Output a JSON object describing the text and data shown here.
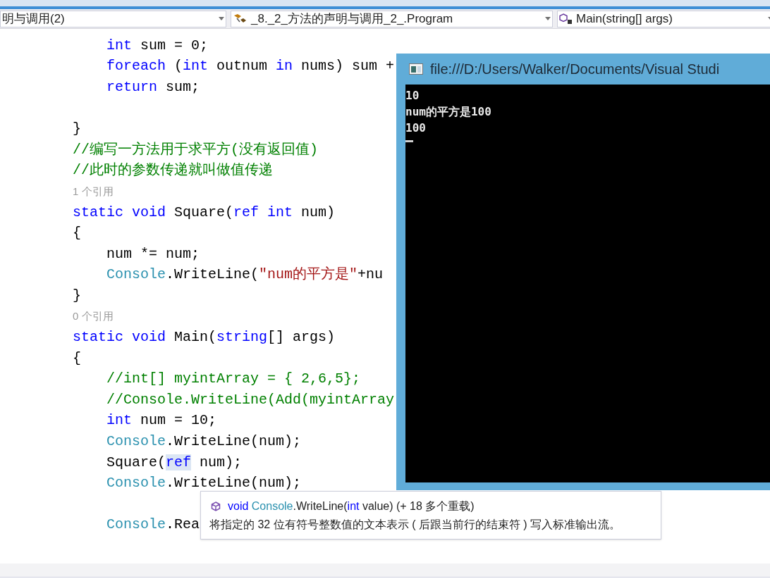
{
  "navigation_bar": {
    "dropdowns": [
      {
        "kind": "project",
        "text": "明与调用(2)"
      },
      {
        "kind": "class",
        "text": "_8._2_方法的声明与调用_2_.Program"
      },
      {
        "kind": "member",
        "text": "Main(string[] args)"
      }
    ]
  },
  "code_lines": [
    {
      "kind": "block",
      "children": [
        {
          "kind": "code",
          "tokens": [
            {
              "kind": "keyword",
              "text": "int"
            },
            {
              "kind": "plain",
              "text": " sum = 0;"
            }
          ]
        },
        {
          "kind": "code",
          "tokens": [
            {
              "kind": "keyword",
              "text": "foreach"
            },
            {
              "kind": "plain",
              "text": " ("
            },
            {
              "kind": "keyword",
              "text": "int"
            },
            {
              "kind": "plain",
              "text": " outnum "
            },
            {
              "kind": "keyword",
              "text": "in"
            },
            {
              "kind": "plain",
              "text": " nums) sum +"
            }
          ]
        },
        {
          "kind": "code",
          "tokens": [
            {
              "kind": "keyword",
              "text": "return"
            },
            {
              "kind": "plain",
              "text": " sum;"
            }
          ]
        },
        {
          "kind": "blank"
        }
      ]
    },
    {
      "kind": "code",
      "tokens": [
        {
          "kind": "plain",
          "text": "}"
        }
      ]
    },
    {
      "kind": "code",
      "tokens": [
        {
          "kind": "comment",
          "text": "//编写一方法用于求平方(没有返回值)"
        }
      ]
    },
    {
      "kind": "code",
      "tokens": [
        {
          "kind": "comment",
          "text": "//此时的参数传递就叫做值传递"
        }
      ]
    },
    {
      "kind": "codelens",
      "text": "1 个引用"
    },
    {
      "kind": "code",
      "tokens": [
        {
          "kind": "keyword",
          "text": "static void"
        },
        {
          "kind": "plain",
          "text": " Square("
        },
        {
          "kind": "keyword",
          "text": "ref int"
        },
        {
          "kind": "plain",
          "text": " num)"
        }
      ]
    },
    {
      "kind": "code",
      "tokens": [
        {
          "kind": "plain",
          "text": "{"
        }
      ]
    },
    {
      "kind": "block",
      "children": [
        {
          "kind": "code",
          "tokens": [
            {
              "kind": "plain",
              "text": "num *= num;"
            }
          ]
        },
        {
          "kind": "code",
          "tokens": [
            {
              "kind": "type",
              "text": "Console"
            },
            {
              "kind": "plain",
              "text": ".WriteLine("
            },
            {
              "kind": "string",
              "text": "\"num的平方是\""
            },
            {
              "kind": "plain",
              "text": "+nu"
            }
          ]
        }
      ]
    },
    {
      "kind": "code",
      "tokens": [
        {
          "kind": "plain",
          "text": "}"
        }
      ]
    },
    {
      "kind": "codelens",
      "text": "0 个引用"
    },
    {
      "kind": "code",
      "tokens": [
        {
          "kind": "keyword",
          "text": "static void"
        },
        {
          "kind": "plain",
          "text": " Main("
        },
        {
          "kind": "keyword",
          "text": "string"
        },
        {
          "kind": "plain",
          "text": "[] args)"
        }
      ]
    },
    {
      "kind": "code",
      "tokens": [
        {
          "kind": "plain",
          "text": "{"
        }
      ]
    },
    {
      "kind": "block",
      "children": [
        {
          "kind": "code",
          "tokens": [
            {
              "kind": "comment",
              "text": "//int[] myintArray = { 2,6,5};"
            }
          ]
        },
        {
          "kind": "code",
          "tokens": [
            {
              "kind": "comment",
              "text": "//Console.WriteLine(Add(myintArray"
            }
          ]
        },
        {
          "kind": "code",
          "tokens": [
            {
              "kind": "keyword",
              "text": "int"
            },
            {
              "kind": "plain",
              "text": " num = 10;"
            }
          ]
        },
        {
          "kind": "code",
          "tokens": [
            {
              "kind": "type",
              "text": "Console"
            },
            {
              "kind": "plain",
              "text": ".WriteLine(num);"
            }
          ]
        },
        {
          "kind": "code",
          "tokens": [
            {
              "kind": "plain",
              "text": "Square("
            },
            {
              "kind": "highlighted_keyword",
              "text": "ref"
            },
            {
              "kind": "plain",
              "text": " num);"
            }
          ]
        },
        {
          "kind": "code",
          "tokens": [
            {
              "kind": "type",
              "text": "Console"
            },
            {
              "kind": "plain",
              "text": ".WriteLine(num);"
            }
          ]
        },
        {
          "kind": "blank"
        },
        {
          "kind": "code",
          "tokens": [
            {
              "kind": "type",
              "text": "Console"
            },
            {
              "kind": "plain",
              "text": ".Rea"
            }
          ]
        }
      ]
    }
  ],
  "console_window": {
    "title": "file:///D:/Users/Walker/Documents/Visual Studi",
    "output_lines": [
      "10",
      "num的平方是100",
      "100"
    ]
  },
  "tooltip": {
    "signature": [
      {
        "kind": "keyword",
        "text": "void"
      },
      {
        "kind": "type",
        "text": " Console"
      },
      {
        "kind": "plain",
        "text": ".WriteLine("
      },
      {
        "kind": "keyword",
        "text": "int"
      },
      {
        "kind": "plain",
        "text": " value) (+ 18 多个重载)"
      }
    ],
    "description": "将指定的 32 位有符号整数值的文本表示 ( 后跟当前行的结束符 ) 写入标准输出流。"
  }
}
